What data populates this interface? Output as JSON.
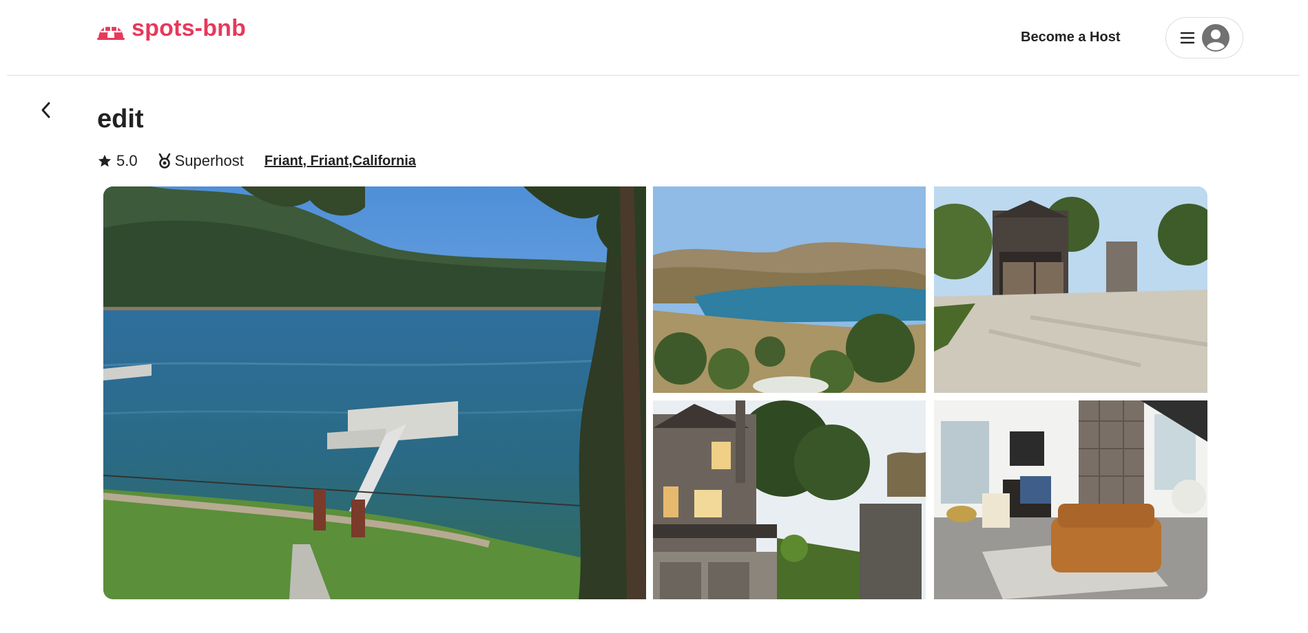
{
  "header": {
    "brand": "spots-bnb",
    "brand_color": "#e8385c",
    "logo_icon": "igloo-icon",
    "host_link": "Become a Host",
    "menu_icon": "hamburger-menu-icon",
    "avatar_icon": "user-avatar-icon"
  },
  "listing": {
    "back_icon": "chevron-left-icon",
    "title": "edit",
    "rating_icon": "star-icon",
    "rating": "5.0",
    "superhost_icon": "medal-icon",
    "superhost": "Superhost",
    "location": "Friant, Friant,California"
  },
  "gallery": {
    "photos": [
      {
        "name": "lake-dock-photo",
        "subject": "lake with floating dock"
      },
      {
        "name": "lake-hills-photo",
        "subject": "lake among hills"
      },
      {
        "name": "house-driveway-photo",
        "subject": "house with driveway"
      },
      {
        "name": "house-exterior-photo",
        "subject": "house exterior at dusk"
      },
      {
        "name": "living-room-photo",
        "subject": "living room interior"
      }
    ]
  }
}
